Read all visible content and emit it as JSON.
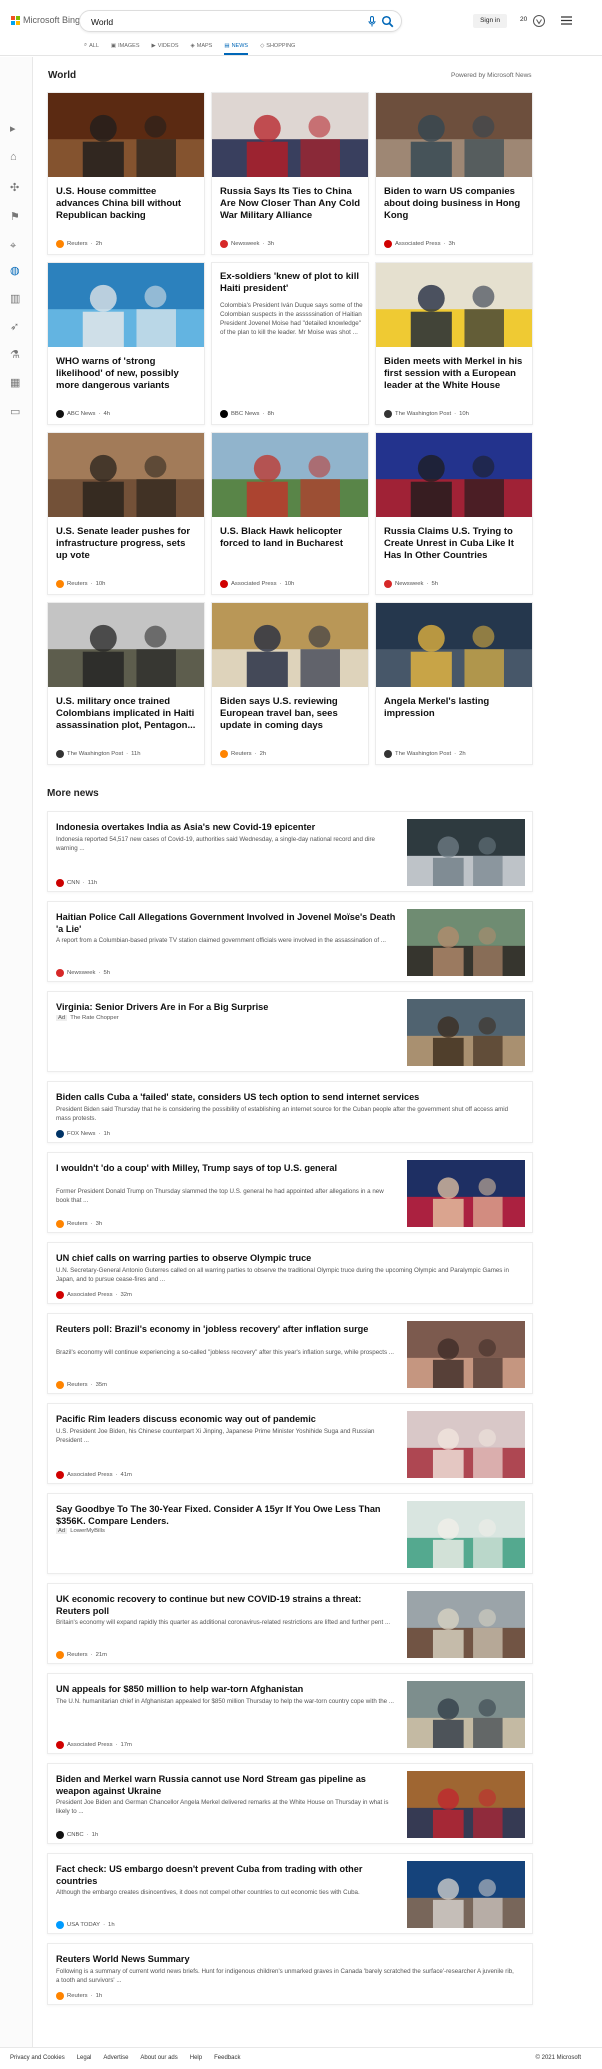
{
  "brand": {
    "logo_text": "Microsoft Bing"
  },
  "search": {
    "value": "World"
  },
  "tabs": [
    {
      "label": "ALL"
    },
    {
      "label": "IMAGES"
    },
    {
      "label": "VIDEOS"
    },
    {
      "label": "MAPS"
    },
    {
      "label": "NEWS"
    },
    {
      "label": "SHOPPING"
    }
  ],
  "account": {
    "signin_label": "Sign in",
    "points": "20"
  },
  "colors": {
    "accent": "#0067b8",
    "card_border": "#ececec",
    "rail_bg": "#fbfbfb"
  },
  "rail_icons": [
    "expand-icon",
    "home-icon",
    "coronavirus-icon",
    "flag-icon",
    "location-pin-icon",
    "globe-icon",
    "chart-icon",
    "rocket-icon",
    "flask-icon",
    "landmark-icon",
    "tv-icon"
  ],
  "section": {
    "title": "World",
    "powered_by": "Powered by Microsoft News"
  },
  "top_stories": [
    {
      "title": "U.S. House committee advances China bill without Republican backing",
      "source": "Reuters",
      "time": "2h",
      "source_color": "#ff8400",
      "icon": "person-mask-photo-icon"
    },
    {
      "title": "Russia Says Its Ties to China Are Now Closer Than Any Cold War Military Alliance",
      "source": "Newsweek",
      "time": "3h",
      "source_color": "#d62828",
      "icon": "diplomats-photo-icon"
    },
    {
      "title": "Biden to warn US companies about doing business in Hong Kong",
      "source": "Associated Press",
      "time": "3h",
      "source_color": "#d00000",
      "icon": "crowd-photo-icon"
    },
    {
      "title": "WHO warns of 'strong likelihood' of new, possibly more dangerous variants",
      "source": "ABC News",
      "time": "4h",
      "source_color": "#111111",
      "icon": "who-photo-icon"
    },
    {
      "title": "Ex-soldiers 'knew of plot to kill Haiti president'",
      "description": "Colombia's President Iván Duque says some of the Colombian suspects in the asssssination of Haitian President Jovenel Moise had \"detailed knowledge\" of the plan to kill the leader. Mr Moise was shot ...",
      "source": "BBC News",
      "time": "8h",
      "source_color": "#000000"
    },
    {
      "title": "Biden meets with Merkel in his first session with a European leader at the White House",
      "source": "The Washington Post",
      "time": "10h",
      "source_color": "#333333",
      "icon": "merkel-harris-photo-icon"
    },
    {
      "title": "U.S. Senate leader pushes for infrastructure progress, sets up vote",
      "source": "Reuters",
      "time": "10h",
      "source_color": "#ff8400",
      "icon": "senator-photo-icon"
    },
    {
      "title": "U.S. Black Hawk helicopter forced to land in Bucharest",
      "source": "Associated Press",
      "time": "10h",
      "source_color": "#d00000",
      "icon": "firetruck-photo-icon"
    },
    {
      "title": "Russia Claims U.S. Trying to Create Unrest in Cuba Like It Has In Other Countries",
      "source": "Newsweek",
      "time": "5h",
      "source_color": "#d62828",
      "icon": "leaders-flags-photo-icon"
    },
    {
      "title": "U.S. military once trained Colombians implicated in Haiti assassination plot, Pentagon...",
      "source": "The Washington Post",
      "time": "11h",
      "source_color": "#333333",
      "icon": "soldiers-photo-icon"
    },
    {
      "title": "Biden says U.S. reviewing European travel ban, sees update in coming days",
      "source": "Reuters",
      "time": "2h",
      "source_color": "#ff8400",
      "icon": "press-conference-photo-icon"
    },
    {
      "title": "Angela Merkel's lasting impression",
      "source": "The Washington Post",
      "time": "2h",
      "source_color": "#333333",
      "icon": "white-house-photo-icon"
    }
  ],
  "more_news": {
    "title": "More news",
    "items": [
      {
        "title": "Indonesia overtakes India as Asia's new Covid-19 epicenter",
        "description": "Indonesia reported 54,517 new cases of Covid-19, authorities said Wednesday, a single-day national record and dire warning ...",
        "source": "CNN",
        "time": "11h",
        "source_color": "#cc0000",
        "icon": "ppe-worker-photo-icon"
      },
      {
        "title": "Haitian Police Call Allegations Government Involved in Jovenel Moïse's Death 'a Lie'",
        "description": "A report from a Columbian-based private TV station claimed government officials were involved in the assassination of ...",
        "source": "Newsweek",
        "time": "5h",
        "source_color": "#d62828",
        "icon": "street-crowd-photo-icon"
      },
      {
        "title": "Virginia: Senior Drivers Are in For a Big Surprise",
        "ad": "Ad",
        "source": "The Rate Chopper",
        "icon": "driver-photo-icon"
      },
      {
        "title": "Biden calls Cuba a 'failed' state, considers US tech option to send internet services",
        "description": "President Biden said Thursday that he is considering the possibility of establishing an internet source for the Cuban people after the government shut off access amid mass protests.",
        "source": "FOX News",
        "time": "1h",
        "source_color": "#003366"
      },
      {
        "title": "I wouldn't 'do a coup' with Milley, Trump says of top U.S. general",
        "description": "Former President Donald Trump on Thursday slammed the top U.S. general he had appointed after allegations in a new book that ...",
        "source": "Reuters",
        "time": "3h",
        "source_color": "#ff8400",
        "icon": "trump-general-photo-icon"
      },
      {
        "title": "UN chief calls on warring parties to observe Olympic truce",
        "description": "U.N. Secretary-General Antonio Guterres called on all warring parties to observe the traditional Olympic truce during the upcoming Olympic and Paralympic Games in Japan, and to pursue cease-fires and ...",
        "source": "Associated Press",
        "time": "32m",
        "source_color": "#d00000"
      },
      {
        "title": "Reuters poll: Brazil's economy in 'jobless recovery' after inflation surge",
        "description": "Brazil's economy will continue experiencing a so-called \"jobless recovery\" after this year's inflation surge, while prospects ...",
        "source": "Reuters",
        "time": "35m",
        "source_color": "#ff8400",
        "icon": "market-photo-icon"
      },
      {
        "title": "Pacific Rim leaders discuss economic way out of pandemic",
        "description": "U.S. President Joe Biden, his Chinese counterpart Xi Jinping, Japanese Prime Minister Yoshihide Suga and Russian President ...",
        "source": "Associated Press",
        "time": "41m",
        "source_color": "#d00000",
        "icon": "video-call-photo-icon"
      },
      {
        "title": "Say Goodbye To The 30-Year Fixed. Consider A 15yr If You Owe Less Than $356K. Compare Lenders.",
        "ad": "Ad",
        "source": "LowerMyBills",
        "icon": "calculator-photo-icon"
      },
      {
        "title": "UK economic recovery to continue but new COVID-19 strains a threat: Reuters poll",
        "description": "Britain's economy will expand rapidly this quarter as additional coronavirus-related restrictions are lifted and further pent ...",
        "source": "Reuters",
        "time": "21m",
        "source_color": "#ff8400",
        "icon": "uk-street-photo-icon"
      },
      {
        "title": "UN appeals for $850 million to help war-torn Afghanistan",
        "description": "The U.N. humanitarian chief in Afghanistan appealed for $850 million Thursday to help the war-torn country cope with the ...",
        "source": "Associated Press",
        "time": "17m",
        "source_color": "#d00000",
        "icon": "afghan-photo-icon"
      },
      {
        "title": "Biden and Merkel warn Russia cannot use Nord Stream gas pipeline as weapon against Ukraine",
        "description": "President Joe Biden and German Chancellor Angela Merkel delivered remarks at the White House on Thursday in what is likely to ...",
        "source": "CNBC",
        "time": "1h",
        "source_color": "#111111",
        "icon": "podium-photo-icon"
      },
      {
        "title": "Fact check: US embargo doesn't prevent Cuba from trading with other countries",
        "description": "Although the embargo creates disincentives, it does not compel other countries to cut economic ties with Cuba.",
        "source": "USA TODAY",
        "time": "1h",
        "source_color": "#009bff",
        "icon": "protest-crowd-photo-icon"
      },
      {
        "title": "Reuters World News Summary",
        "description": "Following is a summary of current world news briefs. Hunt for indigenous children's unmarked graves in Canada 'barely scratched the surface'-researcher A juvenile rib, a tooth and survivors' ...",
        "source": "Reuters",
        "time": "1h",
        "source_color": "#ff8400"
      }
    ]
  },
  "footer": {
    "links": [
      "Privacy and Cookies",
      "Legal",
      "Advertise",
      "About our ads",
      "Help",
      "Feedback"
    ],
    "copyright": "© 2021 Microsoft"
  }
}
